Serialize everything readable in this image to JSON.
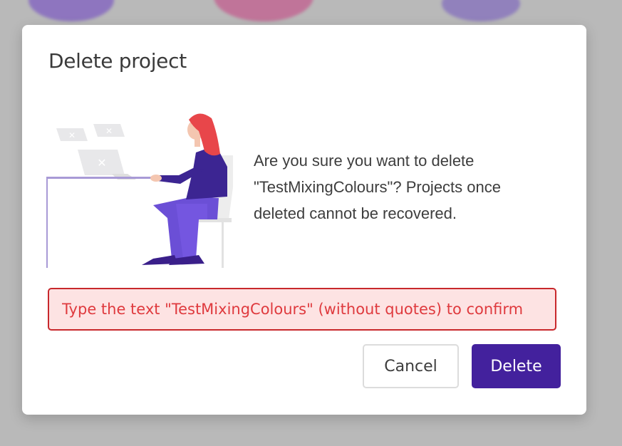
{
  "dialog": {
    "title": "Delete project",
    "message": "Are you sure you want to delete \"TestMixingColours\"? Projects once deleted cannot be recovered.",
    "confirm_input": {
      "value": "",
      "placeholder": "Type the text \"TestMixingColours\" (without quotes) to confirm"
    },
    "buttons": {
      "cancel_label": "Cancel",
      "delete_label": "Delete"
    },
    "illustration": {
      "icon": "person-at-laptop-illustration"
    }
  },
  "colors": {
    "primary": "#43219d",
    "error_border": "#c8282c",
    "error_background": "#fde3e3",
    "error_text": "#df3a3e",
    "overlay": "#b9b9b9"
  }
}
